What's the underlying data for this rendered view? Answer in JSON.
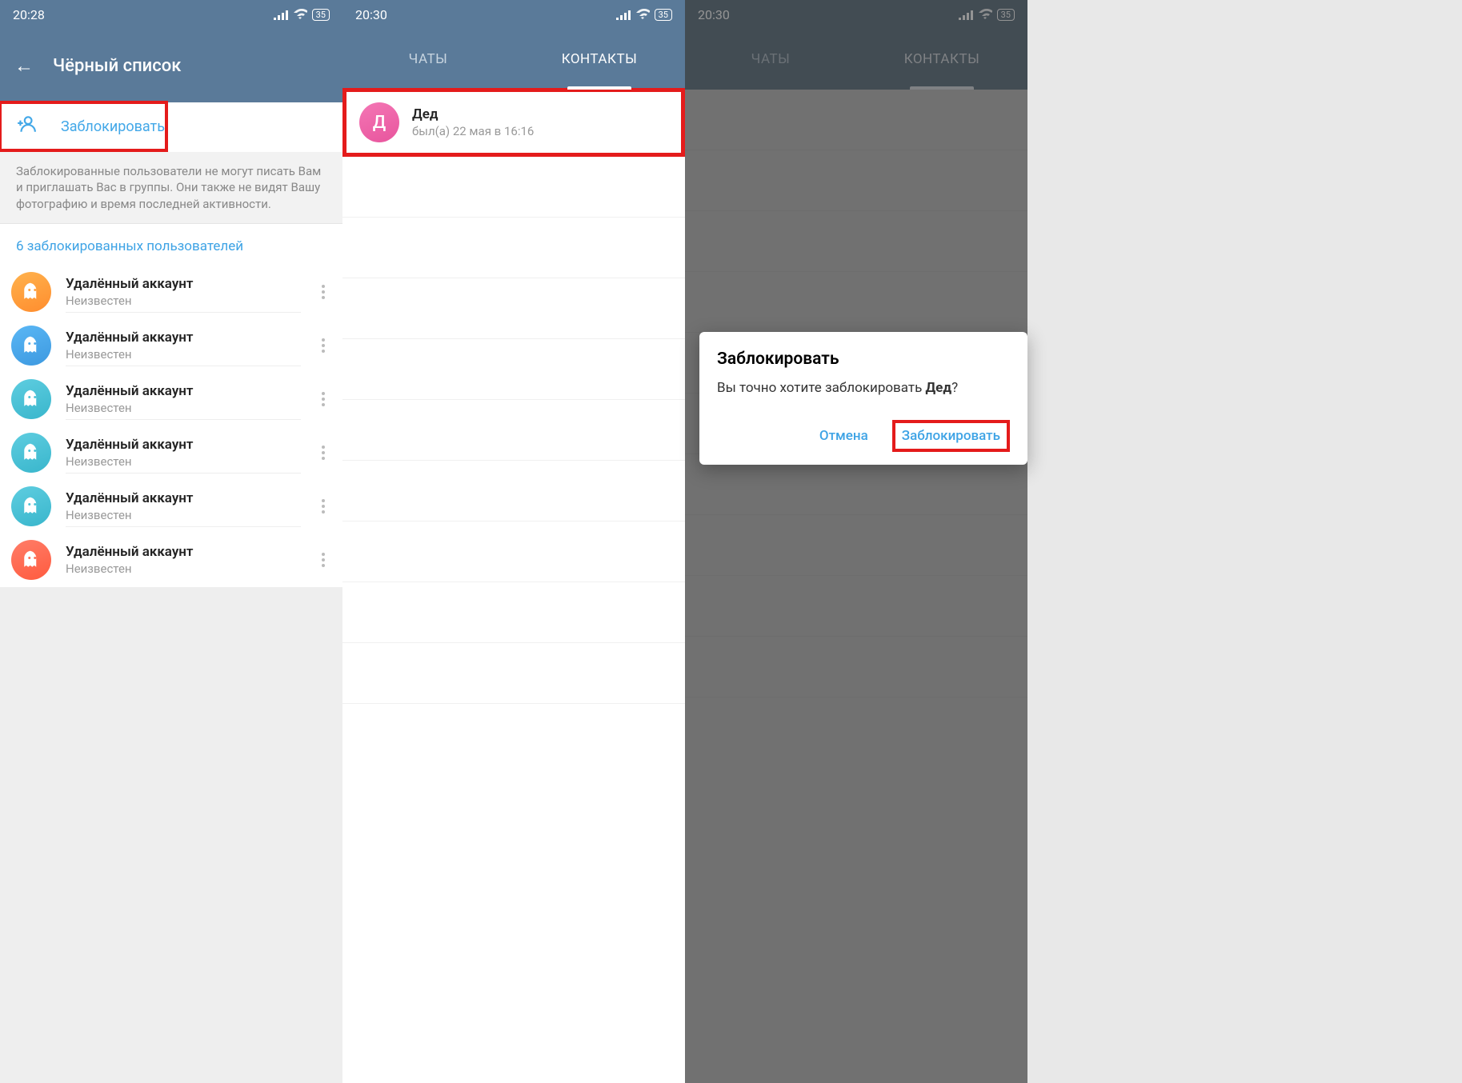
{
  "screen1": {
    "status": {
      "time": "20:28",
      "battery": "35"
    },
    "header": {
      "title": "Чёрный список"
    },
    "blockBtn": {
      "label": "Заблокировать"
    },
    "infoText": "Заблокированные пользователи не могут писать Вам и приглашать Вас в группы. Они также не видят Вашу фотографию и время последней активности.",
    "sectionHeader": "6 заблокированных пользователей",
    "items": [
      {
        "name": "Удалённый аккаунт",
        "status": "Неизвестен",
        "color": "av-orange"
      },
      {
        "name": "Удалённый аккаунт",
        "status": "Неизвестен",
        "color": "av-blue"
      },
      {
        "name": "Удалённый аккаунт",
        "status": "Неизвестен",
        "color": "av-cyan"
      },
      {
        "name": "Удалённый аккаунт",
        "status": "Неизвестен",
        "color": "av-cyan"
      },
      {
        "name": "Удалённый аккаунт",
        "status": "Неизвестен",
        "color": "av-cyan"
      },
      {
        "name": "Удалённый аккаунт",
        "status": "Неизвестен",
        "color": "av-red"
      }
    ]
  },
  "screen2": {
    "status": {
      "time": "20:30",
      "battery": "35"
    },
    "tabs": {
      "chats": "ЧАТЫ",
      "contacts": "КОНТАКТЫ"
    },
    "contact": {
      "name": "Дед",
      "status": "был(а) 22 мая в 16:16",
      "initial": "Д"
    }
  },
  "screen3": {
    "status": {
      "time": "20:30",
      "battery": "35"
    },
    "tabs": {
      "chats": "ЧАТЫ",
      "contacts": "КОНТАКТЫ"
    },
    "dialog": {
      "title": "Заблокировать",
      "textPrefix": "Вы точно хотите заблокировать ",
      "textBold": "Дед",
      "textSuffix": "?",
      "cancel": "Отмена",
      "confirm": "Заблокировать"
    }
  }
}
